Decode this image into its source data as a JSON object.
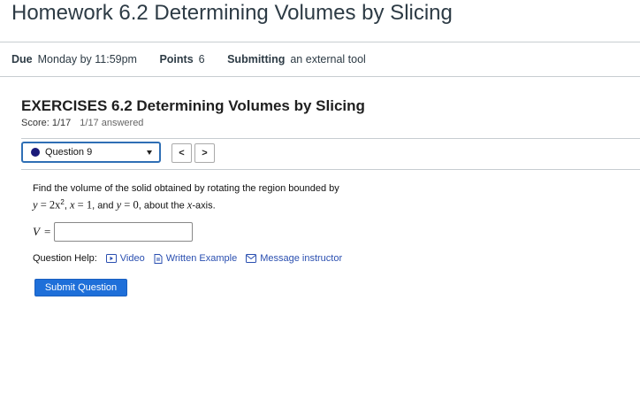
{
  "assignment": {
    "title": "Homework 6.2 Determining Volumes by Slicing",
    "due_label": "Due",
    "due_value": "Monday by 11:59pm",
    "points_label": "Points",
    "points_value": "6",
    "submitting_label": "Submitting",
    "submitting_value": "an external tool"
  },
  "exercise": {
    "title": "EXERCISES 6.2 Determining Volumes by Slicing",
    "score": "Score: 1/17",
    "answered": "1/17 answered"
  },
  "question_nav": {
    "selected": "Question 9",
    "prev_label": "<",
    "next_label": ">"
  },
  "question": {
    "line1": "Find the volume of the solid obtained by rotating the region bounded by",
    "y_var": "y",
    "eq1_rhs": "2x",
    "exp": "2",
    "x_var": "x",
    "eq2_rhs": "1",
    "and_text": ", and",
    "eq3_rhs": "0",
    "about_text": ", about the",
    "axis_text": "-axis."
  },
  "answer": {
    "var": "V",
    "eq": "=",
    "value": ""
  },
  "help": {
    "label": "Question Help:",
    "video": "Video",
    "written": "Written Example",
    "message": "Message instructor"
  },
  "submit_label": "Submit Question",
  "colors": {
    "link": "#2a4fb0",
    "submit_bg": "#1e6fd9",
    "select_border": "#2f6fb5",
    "question_dot": "#1a1a7a"
  }
}
